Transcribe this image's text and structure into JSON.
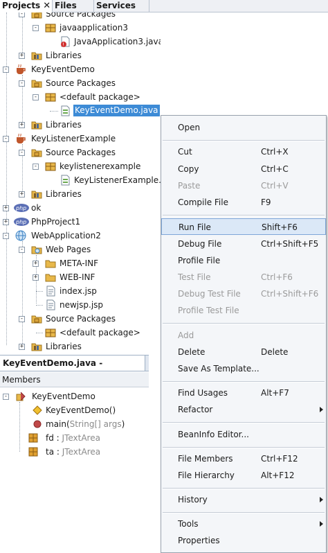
{
  "tabs": {
    "projects": "Projects",
    "close_glyph": "✕",
    "files": "Files",
    "services": "Services"
  },
  "tree": {
    "source_packages_1": "Source Packages",
    "javaapplication3": "javaapplication3",
    "javaapplication3_java": "JavaApplication3.java",
    "libraries_1": "Libraries",
    "keyeventdemo": "KeyEventDemo",
    "source_packages_2": "Source Packages",
    "default_package_1": "<default package>",
    "keyeventdemo_java": "KeyEventDemo.java",
    "libraries_2": "Libraries",
    "keylistenerexample": "KeyListenerExample",
    "source_packages_3": "Source Packages",
    "keylistenerexample_pkg": "keylistenerexample",
    "keylistenerexample_java": "KeyListenerExample.",
    "libraries_3": "Libraries",
    "ok": "ok",
    "phpproject1": "PhpProject1",
    "webapplication2": "WebApplication2",
    "web_pages": "Web Pages",
    "meta_inf": "META-INF",
    "web_inf": "WEB-INF",
    "index_jsp": "index.jsp",
    "newjsp_jsp": "newjsp.jsp",
    "source_packages_4": "Source Packages",
    "default_package_2": "<default package>",
    "libraries_4": "Libraries"
  },
  "navigator": {
    "tab_label": "KeyEventDemo.java - Navigator",
    "close_glyph": "✕",
    "members_label": "Members",
    "class_name": "KeyEventDemo",
    "constructor": "KeyEventDemo()",
    "main_name": "main(",
    "main_params": "String[] args",
    "main_close": ")",
    "field_fd_name": "fd : ",
    "field_fd_type": "JTextArea",
    "field_ta_name": "ta : ",
    "field_ta_type": "JTextArea"
  },
  "menu": {
    "open": "Open",
    "cut": "Cut",
    "cut_sc": "Ctrl+X",
    "copy": "Copy",
    "copy_sc": "Ctrl+C",
    "paste": "Paste",
    "paste_sc": "Ctrl+V",
    "compile_file": "Compile File",
    "compile_file_sc": "F9",
    "run_file": "Run File",
    "run_file_sc": "Shift+F6",
    "debug_file": "Debug File",
    "debug_file_sc": "Ctrl+Shift+F5",
    "profile_file": "Profile File",
    "test_file": "Test File",
    "test_file_sc": "Ctrl+F6",
    "debug_test_file": "Debug Test File",
    "debug_test_file_sc": "Ctrl+Shift+F6",
    "profile_test_file": "Profile Test File",
    "add": "Add",
    "delete": "Delete",
    "delete_sc": "Delete",
    "save_as_template": "Save As Template...",
    "find_usages": "Find Usages",
    "find_usages_sc": "Alt+F7",
    "refactor": "Refactor",
    "beaninfo_editor": "BeanInfo Editor...",
    "file_members": "File Members",
    "file_members_sc": "Ctrl+F12",
    "file_hierarchy": "File Hierarchy",
    "file_hierarchy_sc": "Alt+F12",
    "history": "History",
    "tools": "Tools",
    "properties": "Properties"
  },
  "colors": {
    "selection": "#3d8bd6",
    "menu_highlight": "#dbe8f7",
    "folder": "#e8b84a",
    "package": "#d9a43a",
    "java_file": "#6aa84f",
    "project_cup": "#c0562b",
    "php": "#5b6fb5",
    "globe": "#3b82c4",
    "field": "#e0a030",
    "method": "#c04848"
  }
}
